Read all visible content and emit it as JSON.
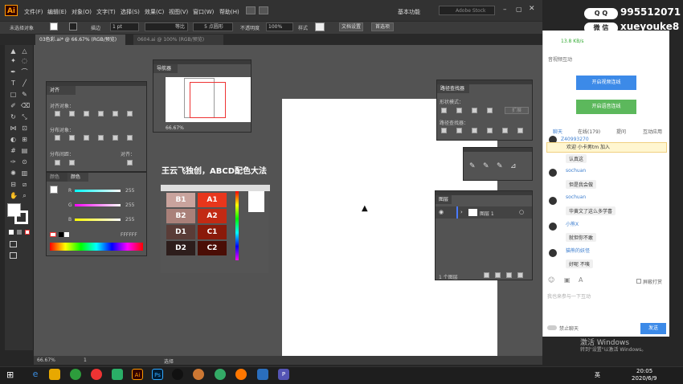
{
  "app": {
    "logo": "Ai",
    "menus": [
      "文件(F)",
      "编辑(E)",
      "对象(O)",
      "文字(T)",
      "选择(S)",
      "效果(C)",
      "视图(V)",
      "窗口(W)",
      "帮助(H)"
    ],
    "workspace_label": "基本功能",
    "search_placeholder": "Adobe Stock"
  },
  "control_bar": {
    "selection_label": "未选择对象",
    "stroke_label": "描边",
    "stroke_value": "1 pt",
    "stroke_profile": "等比",
    "brush_label": "5 点圆形",
    "opacity_label": "不透明度",
    "opacity_value": "100%",
    "style_label": "样式",
    "doc_setup_button": "文档设置",
    "prefs_button": "首选项"
  },
  "tabs": [
    {
      "label": "03色彩.ai* @ 66.67% (RGB/预览)",
      "active": true
    },
    {
      "label": "0604.ai @ 100% (RGB/预览)",
      "active": false
    }
  ],
  "panels": {
    "navigator": {
      "title": "导航器",
      "zoom": "66.67%"
    },
    "align": {
      "title": "对齐",
      "align_objects": "对齐对象：",
      "distribute_objects": "分布对象：",
      "distribute_spacing": "分布间距：",
      "align_to": "对齐："
    },
    "color": {
      "tabs": [
        "颜色",
        "颜色"
      ],
      "channels": [
        {
          "label": "R",
          "value": "255"
        },
        {
          "label": "G",
          "value": "255"
        },
        {
          "label": "B",
          "value": "255"
        }
      ],
      "hex": "FFFFFF"
    },
    "pathfinder": {
      "title": "路径查找器",
      "shape_modes": "形状模式：",
      "expand_button": "扩展",
      "pathfinders": "路径查找器："
    },
    "layers": {
      "title": "图层",
      "layer_name": "图层 1",
      "footer_count": "1 个图层"
    }
  },
  "color_guide": {
    "heading": "王云飞独创，ABCD配色大法",
    "swatches": [
      {
        "label": "B1",
        "color": "#c9a39d"
      },
      {
        "label": "A1",
        "color": "#e8361c"
      },
      {
        "label": "B2",
        "color": "#a98079"
      },
      {
        "label": "A2",
        "color": "#c22a14"
      },
      {
        "label": "D1",
        "color": "#5a3c37"
      },
      {
        "label": "C1",
        "color": "#8a1a0a"
      },
      {
        "label": "D2",
        "color": "#2d1d1b"
      },
      {
        "label": "C2",
        "color": "#4a0d05"
      }
    ]
  },
  "status": {
    "zoom": "66.67%",
    "page": "1",
    "tool_label": "选择"
  },
  "chat": {
    "speed": "13.8 KB/s",
    "section_title": "音视频互动",
    "video_button": "开启视频连线",
    "voice_button": "开启语音连线",
    "tabs": [
      "聊天",
      "在线(179)",
      "提问",
      "互动应用"
    ],
    "system_user": "Z40993270",
    "join_notice": "欢迎 小卡男tm 加入",
    "messages": [
      {
        "name": "",
        "text": "认真这"
      },
      {
        "name": "sochuan",
        "text": "但是我会做"
      },
      {
        "name": "sochuan",
        "text": "华黄文了这么多学喜"
      },
      {
        "name": "小熊X",
        "text": "就但你不敢"
      },
      {
        "name": "猫熊的妖怪",
        "text": "好呢 不咦"
      }
    ],
    "block_label": "屏蔽打赏",
    "input_placeholder": "我也来参与一下互动",
    "mute_label": "禁止聊天",
    "send_button": "发送"
  },
  "overlay": {
    "qq_label": "Q Q",
    "qq_number": "995512071",
    "wechat_label": "微 信",
    "wechat_id": "xueyouke8"
  },
  "watermark": {
    "title": "激活 Windows",
    "subtitle": "转到\"设置\"以激活 Windows。"
  },
  "taskbar": {
    "time": "20:05",
    "date": "2020/6/9",
    "lang": "英"
  }
}
